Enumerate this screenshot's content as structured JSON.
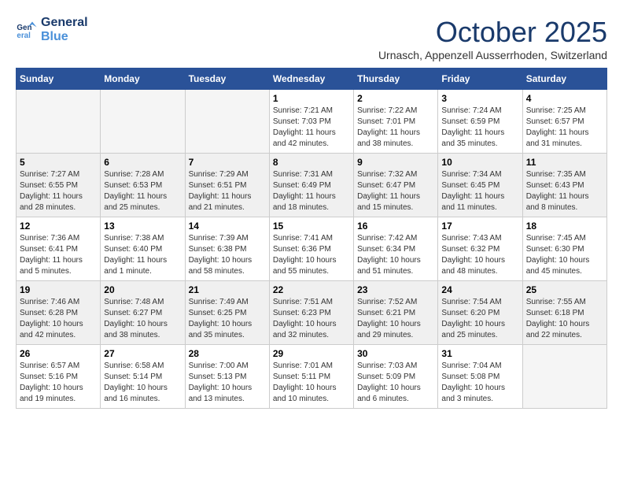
{
  "logo": {
    "line1": "General",
    "line2": "Blue"
  },
  "title": "October 2025",
  "subtitle": "Urnasch, Appenzell Ausserrhoden, Switzerland",
  "weekdays": [
    "Sunday",
    "Monday",
    "Tuesday",
    "Wednesday",
    "Thursday",
    "Friday",
    "Saturday"
  ],
  "weeks": [
    [
      {
        "day": "",
        "info": ""
      },
      {
        "day": "",
        "info": ""
      },
      {
        "day": "",
        "info": ""
      },
      {
        "day": "1",
        "info": "Sunrise: 7:21 AM\nSunset: 7:03 PM\nDaylight: 11 hours\nand 42 minutes."
      },
      {
        "day": "2",
        "info": "Sunrise: 7:22 AM\nSunset: 7:01 PM\nDaylight: 11 hours\nand 38 minutes."
      },
      {
        "day": "3",
        "info": "Sunrise: 7:24 AM\nSunset: 6:59 PM\nDaylight: 11 hours\nand 35 minutes."
      },
      {
        "day": "4",
        "info": "Sunrise: 7:25 AM\nSunset: 6:57 PM\nDaylight: 11 hours\nand 31 minutes."
      }
    ],
    [
      {
        "day": "5",
        "info": "Sunrise: 7:27 AM\nSunset: 6:55 PM\nDaylight: 11 hours\nand 28 minutes."
      },
      {
        "day": "6",
        "info": "Sunrise: 7:28 AM\nSunset: 6:53 PM\nDaylight: 11 hours\nand 25 minutes."
      },
      {
        "day": "7",
        "info": "Sunrise: 7:29 AM\nSunset: 6:51 PM\nDaylight: 11 hours\nand 21 minutes."
      },
      {
        "day": "8",
        "info": "Sunrise: 7:31 AM\nSunset: 6:49 PM\nDaylight: 11 hours\nand 18 minutes."
      },
      {
        "day": "9",
        "info": "Sunrise: 7:32 AM\nSunset: 6:47 PM\nDaylight: 11 hours\nand 15 minutes."
      },
      {
        "day": "10",
        "info": "Sunrise: 7:34 AM\nSunset: 6:45 PM\nDaylight: 11 hours\nand 11 minutes."
      },
      {
        "day": "11",
        "info": "Sunrise: 7:35 AM\nSunset: 6:43 PM\nDaylight: 11 hours\nand 8 minutes."
      }
    ],
    [
      {
        "day": "12",
        "info": "Sunrise: 7:36 AM\nSunset: 6:41 PM\nDaylight: 11 hours\nand 5 minutes."
      },
      {
        "day": "13",
        "info": "Sunrise: 7:38 AM\nSunset: 6:40 PM\nDaylight: 11 hours\nand 1 minute."
      },
      {
        "day": "14",
        "info": "Sunrise: 7:39 AM\nSunset: 6:38 PM\nDaylight: 10 hours\nand 58 minutes."
      },
      {
        "day": "15",
        "info": "Sunrise: 7:41 AM\nSunset: 6:36 PM\nDaylight: 10 hours\nand 55 minutes."
      },
      {
        "day": "16",
        "info": "Sunrise: 7:42 AM\nSunset: 6:34 PM\nDaylight: 10 hours\nand 51 minutes."
      },
      {
        "day": "17",
        "info": "Sunrise: 7:43 AM\nSunset: 6:32 PM\nDaylight: 10 hours\nand 48 minutes."
      },
      {
        "day": "18",
        "info": "Sunrise: 7:45 AM\nSunset: 6:30 PM\nDaylight: 10 hours\nand 45 minutes."
      }
    ],
    [
      {
        "day": "19",
        "info": "Sunrise: 7:46 AM\nSunset: 6:28 PM\nDaylight: 10 hours\nand 42 minutes."
      },
      {
        "day": "20",
        "info": "Sunrise: 7:48 AM\nSunset: 6:27 PM\nDaylight: 10 hours\nand 38 minutes."
      },
      {
        "day": "21",
        "info": "Sunrise: 7:49 AM\nSunset: 6:25 PM\nDaylight: 10 hours\nand 35 minutes."
      },
      {
        "day": "22",
        "info": "Sunrise: 7:51 AM\nSunset: 6:23 PM\nDaylight: 10 hours\nand 32 minutes."
      },
      {
        "day": "23",
        "info": "Sunrise: 7:52 AM\nSunset: 6:21 PM\nDaylight: 10 hours\nand 29 minutes."
      },
      {
        "day": "24",
        "info": "Sunrise: 7:54 AM\nSunset: 6:20 PM\nDaylight: 10 hours\nand 25 minutes."
      },
      {
        "day": "25",
        "info": "Sunrise: 7:55 AM\nSunset: 6:18 PM\nDaylight: 10 hours\nand 22 minutes."
      }
    ],
    [
      {
        "day": "26",
        "info": "Sunrise: 6:57 AM\nSunset: 5:16 PM\nDaylight: 10 hours\nand 19 minutes."
      },
      {
        "day": "27",
        "info": "Sunrise: 6:58 AM\nSunset: 5:14 PM\nDaylight: 10 hours\nand 16 minutes."
      },
      {
        "day": "28",
        "info": "Sunrise: 7:00 AM\nSunset: 5:13 PM\nDaylight: 10 hours\nand 13 minutes."
      },
      {
        "day": "29",
        "info": "Sunrise: 7:01 AM\nSunset: 5:11 PM\nDaylight: 10 hours\nand 10 minutes."
      },
      {
        "day": "30",
        "info": "Sunrise: 7:03 AM\nSunset: 5:09 PM\nDaylight: 10 hours\nand 6 minutes."
      },
      {
        "day": "31",
        "info": "Sunrise: 7:04 AM\nSunset: 5:08 PM\nDaylight: 10 hours\nand 3 minutes."
      },
      {
        "day": "",
        "info": ""
      }
    ]
  ]
}
